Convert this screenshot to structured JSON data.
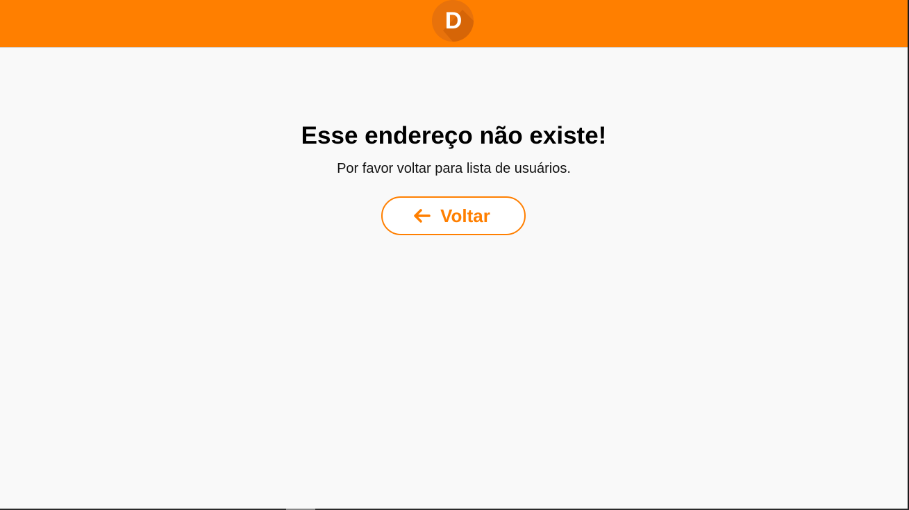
{
  "header": {
    "logo_letter": "D",
    "brand_color": "#ff7f00"
  },
  "main": {
    "title": "Esse endereço não existe!",
    "subtitle": "Por favor voltar para lista de usuários.",
    "back_button": {
      "label": "Voltar",
      "icon": "arrow-left-icon"
    }
  }
}
